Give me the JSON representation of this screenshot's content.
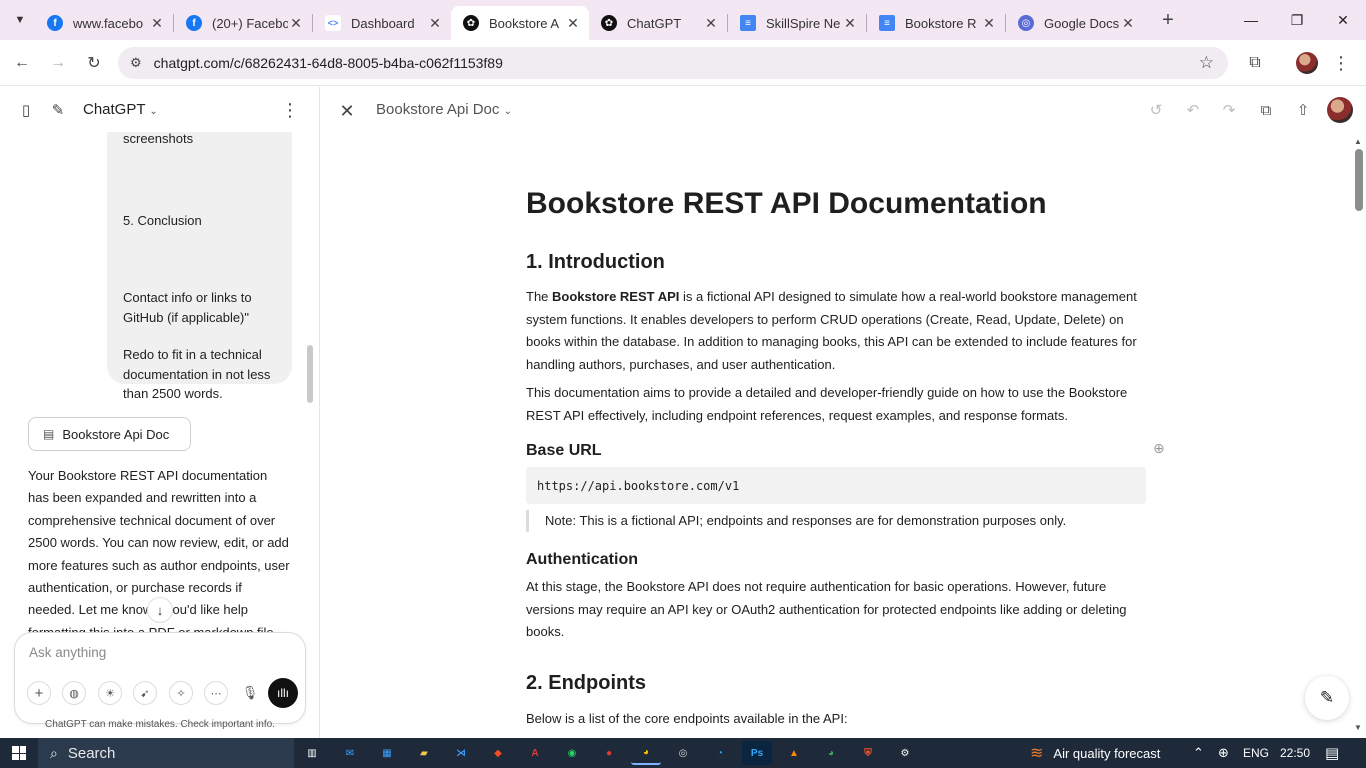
{
  "browser": {
    "tabs": [
      {
        "title": "www.facebo",
        "favicon": "facebook-icon",
        "color": "#1877f2",
        "active": false
      },
      {
        "title": "(20+) Facebo",
        "favicon": "facebook-icon",
        "color": "#1877f2",
        "active": false
      },
      {
        "title": "Dashboard",
        "favicon": "code-icon",
        "color": "#4c8bf5",
        "active": false
      },
      {
        "title": "Bookstore A",
        "favicon": "openai-icon",
        "color": "#111111",
        "active": true
      },
      {
        "title": "ChatGPT",
        "favicon": "openai-icon",
        "color": "#111111",
        "active": false
      },
      {
        "title": "SkillSpire Ne",
        "favicon": "docs-icon",
        "color": "#4285f4",
        "active": false
      },
      {
        "title": "Bookstore R",
        "favicon": "docs-icon",
        "color": "#4285f4",
        "active": false
      },
      {
        "title": "Google Docs",
        "favicon": "globe-icon",
        "color": "#5b6bd6",
        "active": false
      }
    ],
    "url": "chatgpt.com/c/68262431-64d8-8005-b4ba-c062f1153f89"
  },
  "sidebar": {
    "app_name": "ChatGPT",
    "user_message": {
      "line_screenshots": "screenshots",
      "line_conclusion": "5. Conclusion",
      "line_contact": "Contact info or links to GitHub (if applicable)\"",
      "line_redo": "Redo to fit in a technical documentation in not less than 2500 words."
    },
    "doc_chip_label": "Bookstore Api Doc",
    "assistant_reply": "Your Bookstore REST API documentation has been expanded and rewritten into a comprehensive technical document of over 2500 words. You can now review, edit, or add more features such as author endpoints, user authentication, or purchase records if needed. Let me know if you'd like help formatting this into a PDF or markdown file, or turning it into",
    "composer_placeholder": "Ask anything",
    "disclaimer": "ChatGPT can make mistakes. Check important info."
  },
  "canvas": {
    "title": "Bookstore Api Doc",
    "doc": {
      "h1": "Bookstore REST API Documentation",
      "intro_heading": "1. Introduction",
      "intro_p1_pre": "The ",
      "intro_p1_bold": "Bookstore REST API",
      "intro_p1_post": " is a fictional API designed to simulate how a real-world bookstore management system functions. It enables developers to perform CRUD operations (Create, Read, Update, Delete) on books within the database. In addition to managing books, this API can be extended to include features for handling authors, purchases, and user authentication.",
      "intro_p2": "This documentation aims to provide a detailed and developer-friendly guide on how to use the Bookstore REST API effectively, including endpoint references, request examples, and response formats.",
      "base_url_heading": "Base URL",
      "base_url_code": "https://api.bookstore.com/v1",
      "base_url_note": "Note: This is a fictional API; endpoints and responses are for demonstration purposes only.",
      "auth_heading": "Authentication",
      "auth_p": "At this stage, the Bookstore API does not require authentication for basic operations. However, future versions may require an API key or OAuth2 authentication for protected endpoints like adding or deleting books.",
      "endpoints_heading": "2. Endpoints",
      "endpoints_p": "Below is a list of the core endpoints available in the API:"
    }
  },
  "taskbar": {
    "search_label": "Search",
    "weather": "Air quality forecast",
    "language": "ENG",
    "time": "22:50"
  }
}
